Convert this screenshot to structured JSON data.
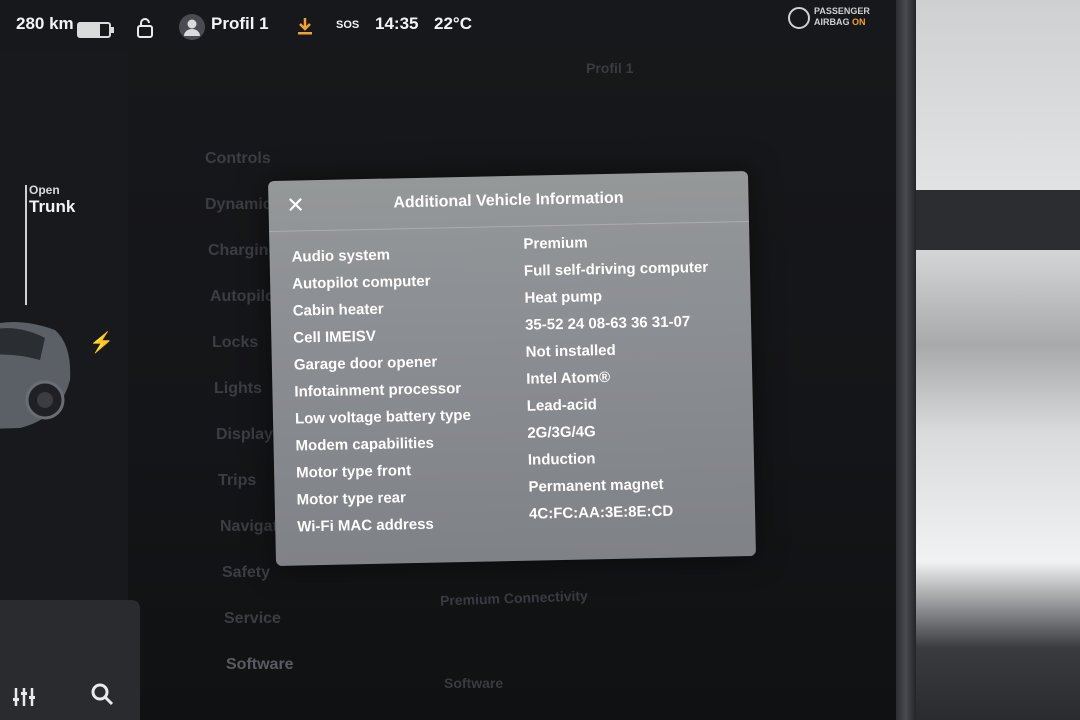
{
  "status_bar": {
    "range": "280 km",
    "profile": "Profil 1",
    "sos": "SOS",
    "time": "14:35",
    "temperature": "22°C",
    "airbag_line1": "PASSENGER",
    "airbag_line2_prefix": "AIRBAG",
    "airbag_state": "ON"
  },
  "car_panel": {
    "trunk_action": "Open",
    "trunk_label": "Trunk"
  },
  "background": {
    "profile_label": "Profil 1",
    "menu_items": [
      "Controls",
      "Dynamics",
      "Charging",
      "Autopilot",
      "Locks",
      "Lights",
      "Display",
      "Trips",
      "Navigation",
      "Safety",
      "Service",
      "Software"
    ],
    "premium_connectivity": "Premium Connectivity",
    "software_label": "Software"
  },
  "modal": {
    "title": "Additional Vehicle Information",
    "rows": [
      {
        "label": "Audio system",
        "value": "Premium"
      },
      {
        "label": "Autopilot computer",
        "value": "Full self-driving computer"
      },
      {
        "label": "Cabin heater",
        "value": "Heat pump"
      },
      {
        "label": "Cell IMEISV",
        "value": "35-52 24 08-63 36 31-07"
      },
      {
        "label": "Garage door opener",
        "value": "Not installed"
      },
      {
        "label": "Infotainment processor",
        "value": "Intel Atom®"
      },
      {
        "label": "Low voltage battery type",
        "value": "Lead-acid"
      },
      {
        "label": "Modem capabilities",
        "value": "2G/3G/4G"
      },
      {
        "label": "Motor type front",
        "value": "Induction"
      },
      {
        "label": "Motor type rear",
        "value": "Permanent magnet"
      },
      {
        "label": "Wi-Fi MAC address",
        "value": "4C:FC:AA:3E:8E:CD"
      }
    ]
  },
  "colors": {
    "accent_download": "#f1a03a",
    "airbag_on": "#f1a03a"
  }
}
